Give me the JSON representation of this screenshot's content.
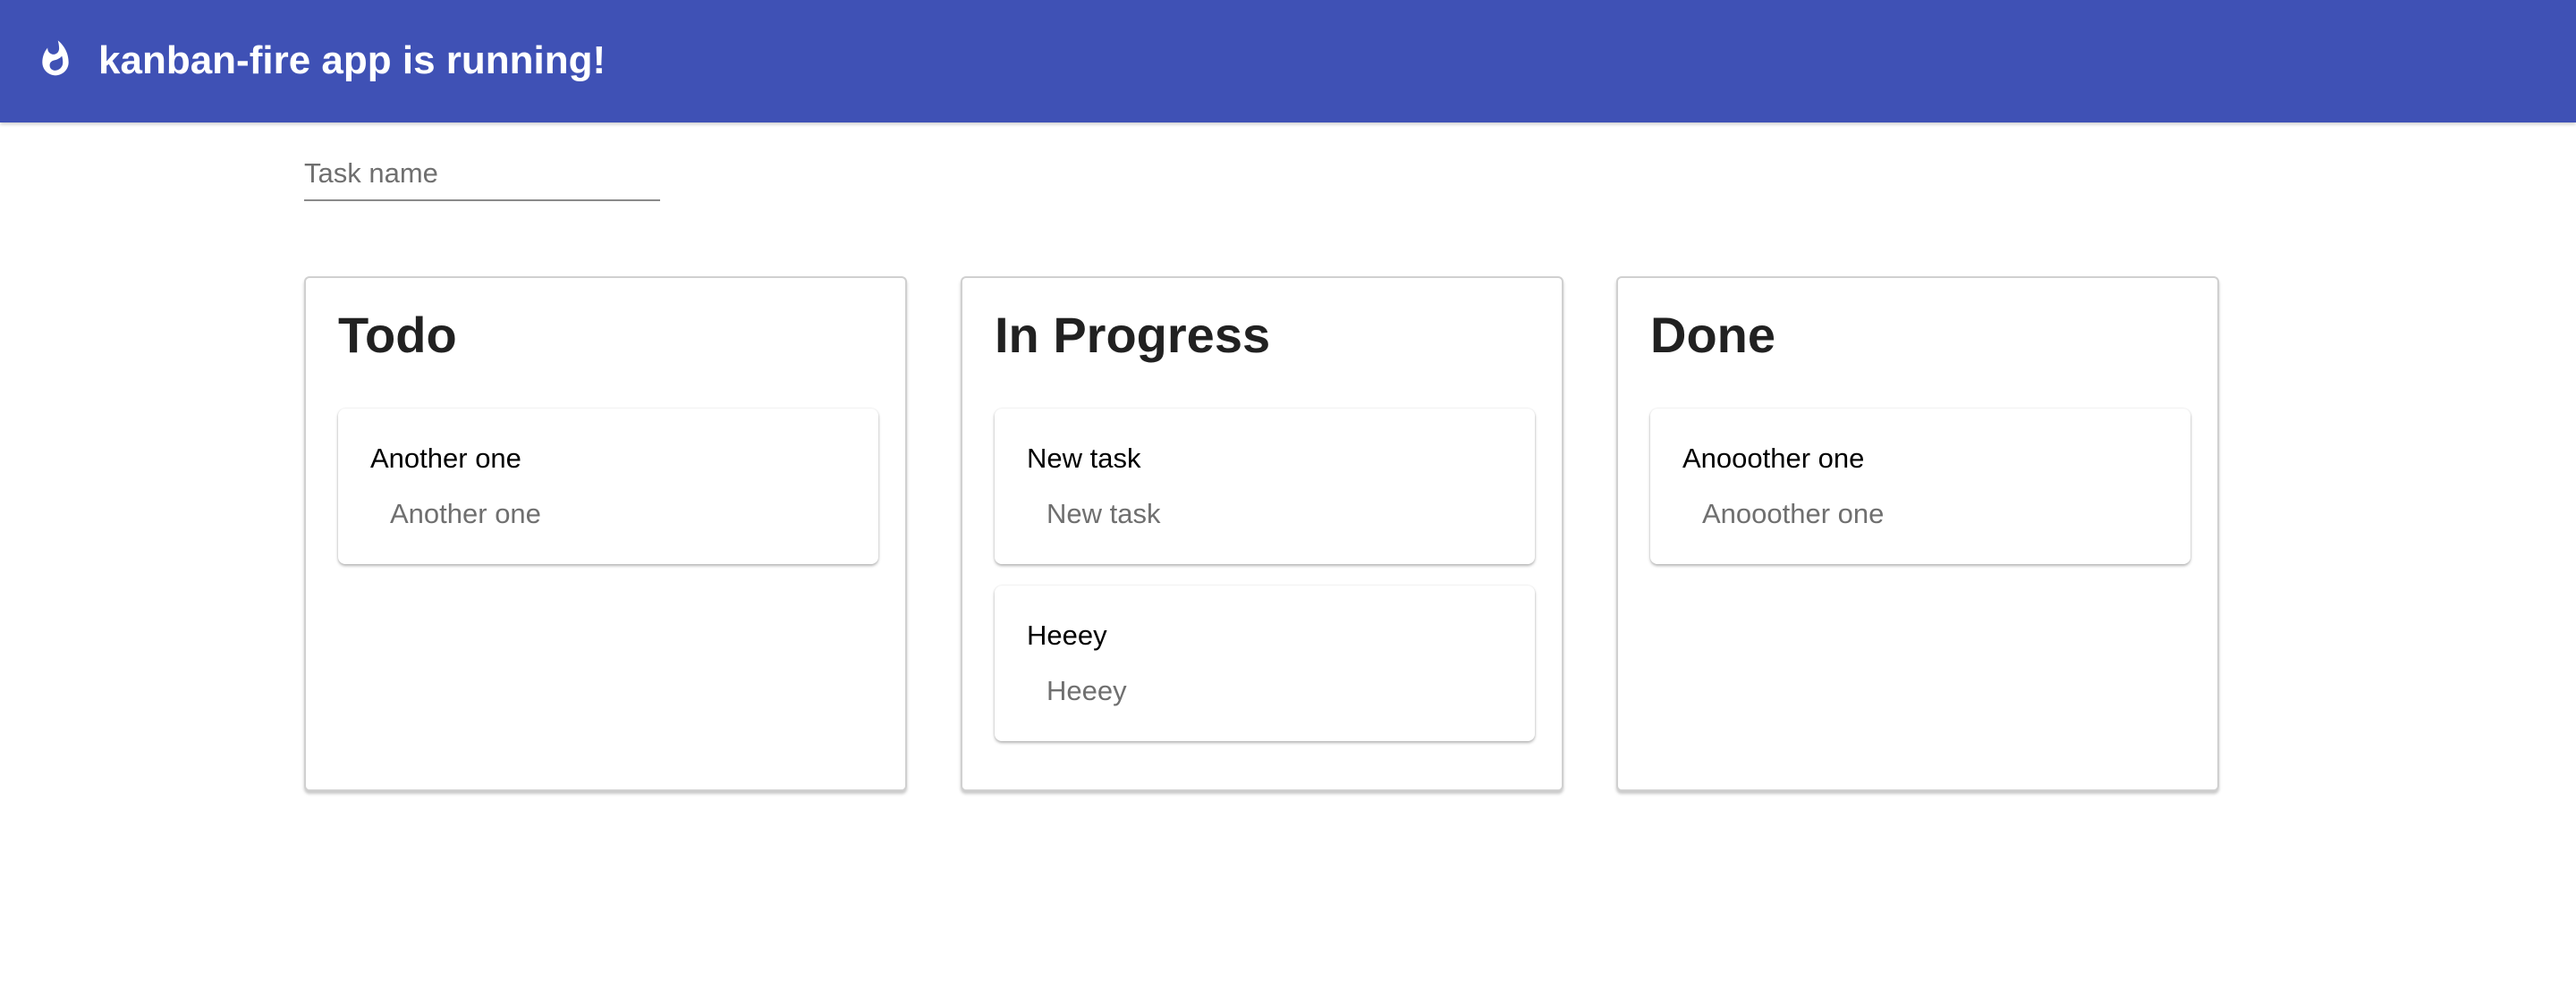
{
  "toolbar": {
    "title": "kanban-fire app is running!",
    "logo_icon": "fire-icon",
    "background_color": "#3f51b5"
  },
  "task_input": {
    "placeholder": "Task name",
    "value": ""
  },
  "columns": [
    {
      "title": "Todo",
      "cards": [
        {
          "title": "Another one",
          "description": "Another one"
        }
      ]
    },
    {
      "title": "In Progress",
      "cards": [
        {
          "title": "New task",
          "description": "New task"
        },
        {
          "title": "Heeey",
          "description": "Heeey"
        }
      ]
    },
    {
      "title": "Done",
      "cards": [
        {
          "title": "Anooother one",
          "description": "Anooother one"
        }
      ]
    }
  ]
}
